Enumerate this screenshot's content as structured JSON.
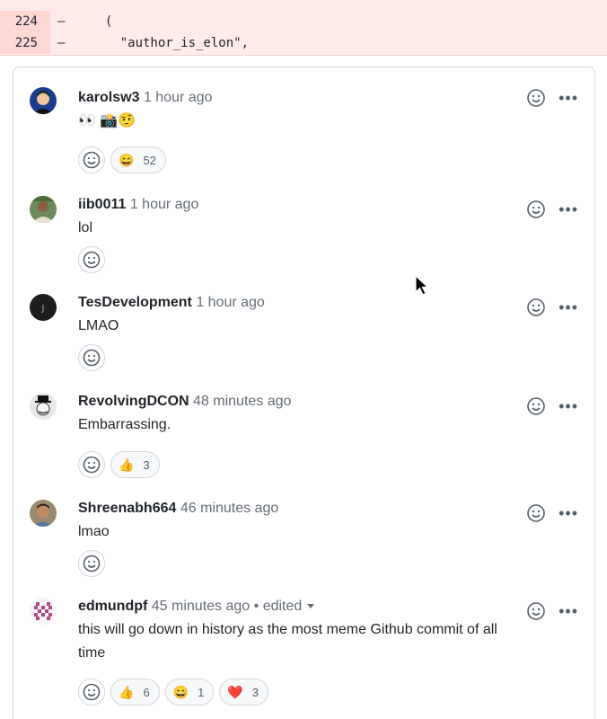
{
  "diff": {
    "lines": [
      {
        "num": "224",
        "sign": "–",
        "code": "  ("
      },
      {
        "num": "225",
        "sign": "–",
        "code": "    \"author_is_elon\","
      }
    ]
  },
  "comments": [
    {
      "author": "karolsw3",
      "time": "1 hour ago",
      "body": "👀 📸🤨",
      "reactions": [
        {
          "emoji": "😄",
          "count": "52"
        }
      ]
    },
    {
      "author": "iib0011",
      "time": "1 hour ago",
      "body": "lol",
      "reactions": []
    },
    {
      "author": "TesDevelopment",
      "time": "1 hour ago",
      "body": "LMAO",
      "reactions": []
    },
    {
      "author": "RevolvingDCON",
      "time": "48 minutes ago",
      "body": "Embarrassing.",
      "reactions": [
        {
          "emoji": "👍",
          "count": "3"
        }
      ]
    },
    {
      "author": "Shreenabh664",
      "time": "46 minutes ago",
      "body": "lmao",
      "reactions": []
    },
    {
      "author": "edmundpf",
      "time": "45 minutes ago",
      "edited": "• edited",
      "body": "this will go down in history as the most meme Github commit of all time",
      "reactions": [
        {
          "emoji": "👍",
          "count": "6"
        },
        {
          "emoji": "😄",
          "count": "1"
        },
        {
          "emoji": "❤️",
          "count": "3"
        }
      ]
    }
  ],
  "colors": {
    "diff_bg": "#ffebe9",
    "diff_num_bg": "#ffd7d5",
    "border": "#d0d7de",
    "muted": "#656d76"
  },
  "icons": {
    "add_reaction": "smiley-icon",
    "more": "kebab-horizontal-icon"
  }
}
